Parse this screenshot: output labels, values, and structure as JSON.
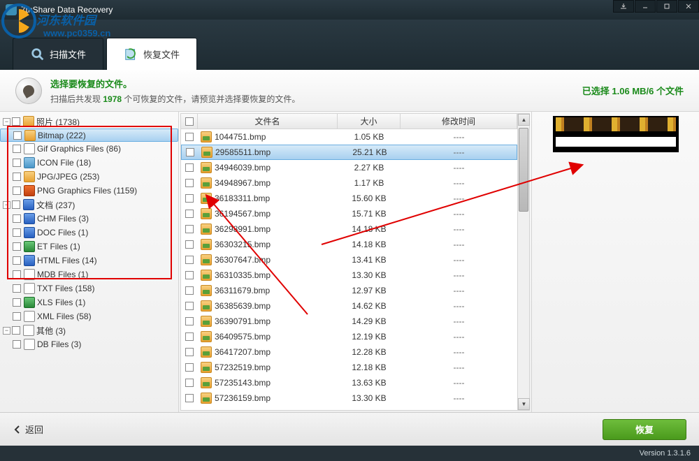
{
  "titlebar": {
    "app_name": "7thShare Data Recovery"
  },
  "watermark": {
    "text": "河东软件园",
    "url": "www.pc0359.cn"
  },
  "tabs": {
    "scan": "扫描文件",
    "recover": "恢复文件"
  },
  "banner": {
    "title": "选择要恢复的文件。",
    "prefix": "扫描后共发现 ",
    "count": "1978",
    "suffix": " 个可恢复的文件，请预览并选择要恢复的文件。",
    "selected_text": "已选择 1.06 MB/6 个文件"
  },
  "tree": {
    "cat_photo": "照片 (1738)",
    "items_photo": [
      "Bitmap (222)",
      "Gif Graphics Files (86)",
      "ICON File (18)",
      "JPG/JPEG (253)",
      "PNG Graphics Files (1159)"
    ],
    "cat_doc": "文档 (237)",
    "items_doc": [
      "CHM Files (3)",
      "DOC Files (1)",
      "ET Files (1)",
      "HTML Files (14)",
      "MDB Files (1)",
      "TXT Files (158)",
      "XLS Files (1)",
      "XML Files (58)"
    ],
    "cat_other": "其他 (3)",
    "items_other": [
      "DB Files (3)"
    ]
  },
  "columns": {
    "name": "文件名",
    "size": "大小",
    "mtime": "修改时间"
  },
  "rows": [
    {
      "name": "1044751.bmp",
      "size": "1.05 KB",
      "mtime": "----"
    },
    {
      "name": "29585511.bmp",
      "size": "25.21 KB",
      "mtime": "----",
      "sel": true
    },
    {
      "name": "34946039.bmp",
      "size": "2.27 KB",
      "mtime": "----"
    },
    {
      "name": "34948967.bmp",
      "size": "1.17 KB",
      "mtime": "----"
    },
    {
      "name": "36183311.bmp",
      "size": "15.60 KB",
      "mtime": "----"
    },
    {
      "name": "36194567.bmp",
      "size": "15.71 KB",
      "mtime": "----"
    },
    {
      "name": "36298991.bmp",
      "size": "14.18 KB",
      "mtime": "----"
    },
    {
      "name": "36303215.bmp",
      "size": "14.18 KB",
      "mtime": "----"
    },
    {
      "name": "36307647.bmp",
      "size": "13.41 KB",
      "mtime": "----"
    },
    {
      "name": "36310335.bmp",
      "size": "13.30 KB",
      "mtime": "----"
    },
    {
      "name": "36311679.bmp",
      "size": "12.97 KB",
      "mtime": "----"
    },
    {
      "name": "36385639.bmp",
      "size": "14.62 KB",
      "mtime": "----"
    },
    {
      "name": "36390791.bmp",
      "size": "14.29 KB",
      "mtime": "----"
    },
    {
      "name": "36409575.bmp",
      "size": "12.19 KB",
      "mtime": "----"
    },
    {
      "name": "36417207.bmp",
      "size": "12.28 KB",
      "mtime": "----"
    },
    {
      "name": "57232519.bmp",
      "size": "12.18 KB",
      "mtime": "----"
    },
    {
      "name": "57235143.bmp",
      "size": "13.63 KB",
      "mtime": "----"
    },
    {
      "name": "57236159.bmp",
      "size": "13.30 KB",
      "mtime": "----"
    }
  ],
  "footer": {
    "back": "返回",
    "recover": "恢复"
  },
  "version": "Version 1.3.1.6"
}
